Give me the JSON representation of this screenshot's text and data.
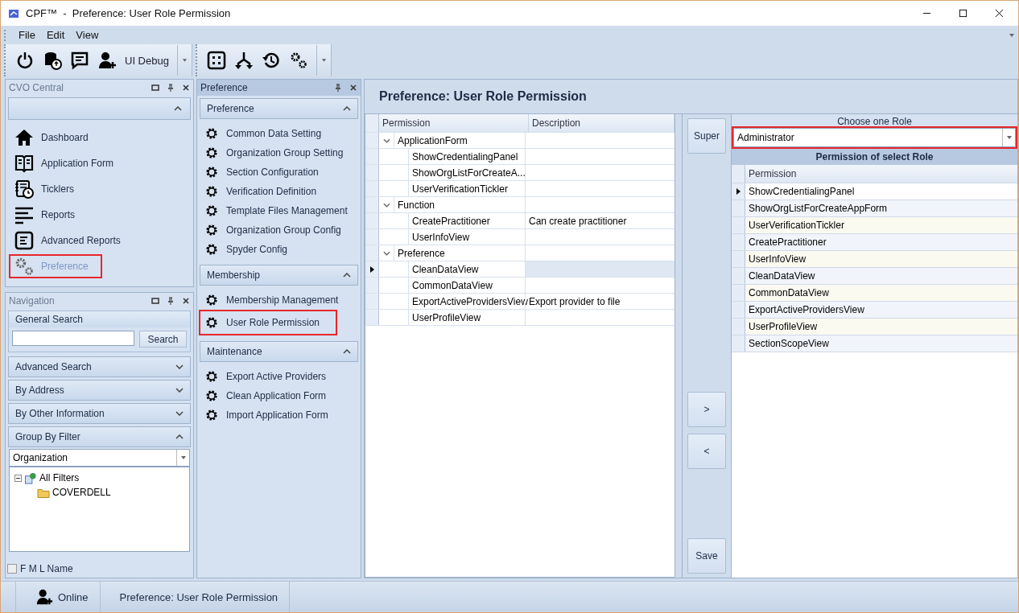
{
  "window": {
    "title": "CPF™  -  Preference: User Role Permission"
  },
  "menu": [
    "File",
    "Edit",
    "View"
  ],
  "toolbar": {
    "debug_label": "UI Debug"
  },
  "cvo_central": {
    "title": "CVO Central",
    "items": [
      {
        "label": "Dashboard",
        "kind": "home",
        "selected": false,
        "highlighted": false
      },
      {
        "label": "Application Form",
        "kind": "book",
        "selected": false,
        "highlighted": false
      },
      {
        "label": "Ticklers",
        "kind": "tickler",
        "selected": false,
        "highlighted": false
      },
      {
        "label": "Reports",
        "kind": "lines",
        "selected": false,
        "highlighted": false
      },
      {
        "label": "Advanced Reports",
        "kind": "doc",
        "selected": false,
        "highlighted": false
      },
      {
        "label": "Preference",
        "kind": "gears",
        "selected": true,
        "highlighted": true
      }
    ]
  },
  "navigation": {
    "title": "Navigation",
    "general_search": {
      "title": "General Search",
      "button": "Search"
    },
    "sections": [
      {
        "label": "Advanced Search",
        "expanded": false
      },
      {
        "label": "By Address",
        "expanded": false
      },
      {
        "label": "By Other Information",
        "expanded": false
      },
      {
        "label": "Group By Filter",
        "expanded": true
      }
    ],
    "filter": {
      "value": "Organization"
    },
    "tree": [
      {
        "label": "All Filters",
        "expanded": true,
        "children": [
          {
            "label": "COVERDELL"
          }
        ]
      }
    ],
    "fml_checkbox": {
      "label": "F M L Name",
      "checked": false
    }
  },
  "preference_panel": {
    "title": "Preference",
    "groups": [
      {
        "title": "Preference",
        "expanded": true,
        "items": [
          {
            "label": "Common Data Setting",
            "highlighted": false
          },
          {
            "label": "Organization Group Setting",
            "highlighted": false
          },
          {
            "label": "Section Configuration",
            "highlighted": false
          },
          {
            "label": "Verification Definition",
            "highlighted": false
          },
          {
            "label": "Template Files Management",
            "highlighted": false
          },
          {
            "label": "Organization Group Config",
            "highlighted": false
          },
          {
            "label": "Spyder Config",
            "highlighted": false
          }
        ]
      },
      {
        "title": "Membership",
        "expanded": true,
        "items": [
          {
            "label": "Membership Management",
            "highlighted": false
          },
          {
            "label": "User Role Permission",
            "highlighted": true
          }
        ]
      },
      {
        "title": "Maintenance",
        "expanded": true,
        "items": [
          {
            "label": "Export Active Providers",
            "highlighted": false
          },
          {
            "label": "Clean Application Form",
            "highlighted": false
          },
          {
            "label": "Import Application Form",
            "highlighted": false
          }
        ]
      }
    ]
  },
  "content": {
    "title": "Preference: User Role Permission",
    "permission_grid": {
      "columns": [
        "Permission",
        "Description"
      ],
      "rows": [
        {
          "label": "ApplicationForm",
          "expanded": true,
          "selected": false,
          "children": [
            {
              "label": "ShowCredentialingPanel",
              "selected": false
            },
            {
              "label": "ShowOrgListForCreateA...",
              "selected": false
            },
            {
              "label": "UserVerificationTickler",
              "selected": false
            }
          ]
        },
        {
          "label": "Function",
          "expanded": true,
          "selected": false,
          "children": [
            {
              "label": "CreatePractitioner",
              "description": "Can create practitioner",
              "selected": false
            },
            {
              "label": "UserInfoView",
              "selected": false
            }
          ]
        },
        {
          "label": "Preference",
          "expanded": true,
          "selected": false,
          "children": [
            {
              "label": "CleanDataView",
              "selected": true
            },
            {
              "label": "CommonDataView",
              "selected": false
            },
            {
              "label": "ExportActiveProvidersView",
              "description": "Export provider to file",
              "selected": false
            },
            {
              "label": "UserProfileView",
              "selected": false
            }
          ]
        }
      ]
    },
    "buttons": {
      "super": "Super",
      "add": ">",
      "remove": "<",
      "save": "Save"
    },
    "role": {
      "label": "Choose one Role",
      "value": "Administrator",
      "highlighted": true
    },
    "role_grid": {
      "title": "Permission of select Role",
      "column": "Permission",
      "rows": [
        {
          "label": "ShowCredentialingPanel",
          "selected": true
        },
        {
          "label": "ShowOrgListForCreateAppForm",
          "selected": false
        },
        {
          "label": "UserVerificationTickler",
          "selected": false
        },
        {
          "label": "CreatePractitioner",
          "selected": false
        },
        {
          "label": "UserInfoView",
          "selected": false
        },
        {
          "label": "CleanDataView",
          "selected": false
        },
        {
          "label": "CommonDataView",
          "selected": false
        },
        {
          "label": "ExportActiveProvidersView",
          "selected": false
        },
        {
          "label": "UserProfileView",
          "selected": false
        },
        {
          "label": "SectionScopeView",
          "selected": false
        }
      ]
    }
  },
  "status_bar": {
    "user": "Online",
    "page": "Preference: User Role Permission"
  }
}
